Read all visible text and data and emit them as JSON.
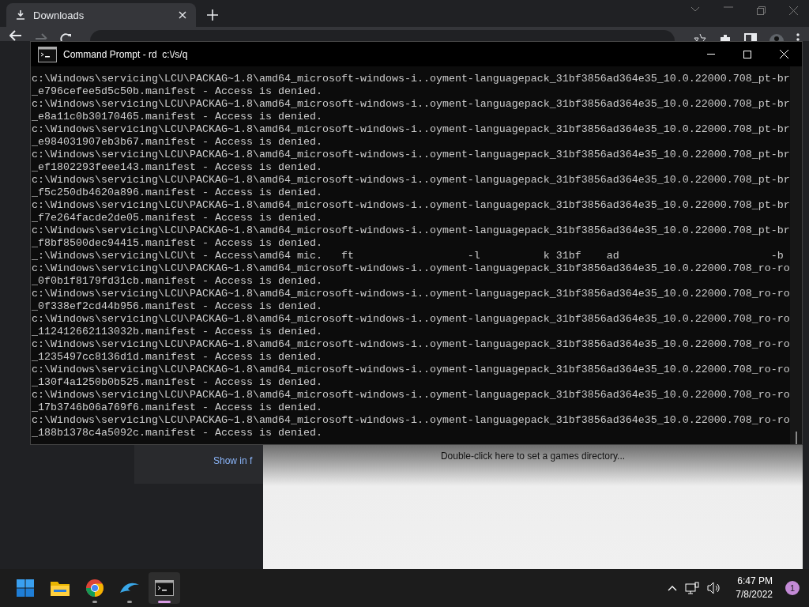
{
  "browser": {
    "tabs": [
      {
        "label": "Downloads",
        "selected": true
      }
    ],
    "content": {
      "link": "Show in f"
    }
  },
  "console": {
    "title": "Command Prompt - rd  c:\\/s/q",
    "lines": [
      "c:\\Windows\\servicing\\LCU\\PACKAG~1.8\\amd64_microsoft-windows-i..oyment-languagepack_31bf3856ad364e35_10.0.22000.708_pt-br",
      "_e796cefee5d5c50b.manifest - Access is denied.",
      "c:\\Windows\\servicing\\LCU\\PACKAG~1.8\\amd64_microsoft-windows-i..oyment-languagepack_31bf3856ad364e35_10.0.22000.708_pt-br",
      "_e8a11c0b30170465.manifest - Access is denied.",
      "c:\\Windows\\servicing\\LCU\\PACKAG~1.8\\amd64_microsoft-windows-i..oyment-languagepack_31bf3856ad364e35_10.0.22000.708_pt-br",
      "_e984031907eb3b67.manifest - Access is denied.",
      "c:\\Windows\\servicing\\LCU\\PACKAG~1.8\\amd64_microsoft-windows-i..oyment-languagepack_31bf3856ad364e35_10.0.22000.708_pt-br",
      "_ef1802293feee143.manifest - Access is denied.",
      "c:\\Windows\\servicing\\LCU\\PACKAG~1.8\\amd64_microsoft-windows-i..oyment-languagepack_31bf3856ad364e35_10.0.22000.708_pt-br",
      "_f5c250db4620a896.manifest - Access is denied.",
      "c:\\Windows\\servicing\\LCU\\PACKAG~1.8\\amd64_microsoft-windows-i..oyment-languagepack_31bf3856ad364e35_10.0.22000.708_pt-br",
      "_f7e264facde2de05.manifest - Access is denied.",
      "c:\\Windows\\servicing\\LCU\\PACKAG~1.8\\amd64_microsoft-windows-i..oyment-languagepack_31bf3856ad364e35_10.0.22000.708_pt-br",
      "_f8bf8500dec94415.manifest - Access is denied.",
      "_:\\Windows\\servicing\\LCU\\t - Access\\amd64 mic.   ft                  -l          k 31bf    ad                        -b",
      "c:\\Windows\\servicing\\LCU\\PACKAG~1.8\\amd64_microsoft-windows-i..oyment-languagepack_31bf3856ad364e35_10.0.22000.708_ro-ro",
      "_0f0b1f8179fd31cb.manifest - Access is denied.",
      "c:\\Windows\\servicing\\LCU\\PACKAG~1.8\\amd64_microsoft-windows-i..oyment-languagepack_31bf3856ad364e35_10.0.22000.708_ro-ro",
      "_0f338ef2cd44b956.manifest - Access is denied.",
      "c:\\Windows\\servicing\\LCU\\PACKAG~1.8\\amd64_microsoft-windows-i..oyment-languagepack_31bf3856ad364e35_10.0.22000.708_ro-ro",
      "_112412662113032b.manifest - Access is denied.",
      "c:\\Windows\\servicing\\LCU\\PACKAG~1.8\\amd64_microsoft-windows-i..oyment-languagepack_31bf3856ad364e35_10.0.22000.708_ro-ro",
      "_1235497cc8136d1d.manifest - Access is denied.",
      "c:\\Windows\\servicing\\LCU\\PACKAG~1.8\\amd64_microsoft-windows-i..oyment-languagepack_31bf3856ad364e35_10.0.22000.708_ro-ro",
      "_130f4a1250b0b525.manifest - Access is denied.",
      "c:\\Windows\\servicing\\LCU\\PACKAG~1.8\\amd64_microsoft-windows-i..oyment-languagepack_31bf3856ad364e35_10.0.22000.708_ro-ro",
      "_17b3746b06a769f6.manifest - Access is denied.",
      "c:\\Windows\\servicing\\LCU\\PACKAG~1.8\\amd64_microsoft-windows-i..oyment-languagepack_31bf3856ad364e35_10.0.22000.708_ro-ro",
      "_188b1378c4a5092c.manifest - Access is denied."
    ]
  },
  "emulator": {
    "message": "Double-click here to set a games directory..."
  },
  "taskbar": {
    "apps": [
      {
        "kind": "start",
        "running": false,
        "selected": false
      },
      {
        "kind": "folder",
        "running": false,
        "selected": false
      },
      {
        "kind": "browser",
        "running": true,
        "selected": false
      },
      {
        "kind": "dolphin",
        "running": true,
        "selected": false
      },
      {
        "kind": "console",
        "running": true,
        "selected": true
      }
    ],
    "time": "6:47 PM",
    "date": "7/8/2022",
    "notifications": "1"
  }
}
